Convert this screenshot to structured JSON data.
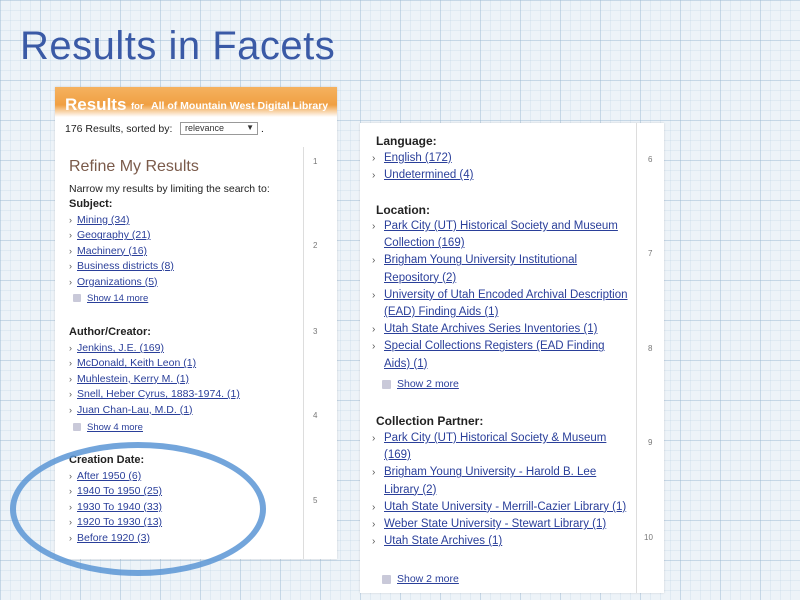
{
  "slide": {
    "title": "Results in Facets"
  },
  "left": {
    "header": {
      "results": "Results",
      "for": "for",
      "library": "All of Mountain West Digital Library"
    },
    "sort": {
      "text": "176 Results, sorted by:",
      "selected": "relevance",
      "caret": "▼",
      "dot": "."
    },
    "refine_title": "Refine My Results",
    "narrow_text": "Narrow my results by limiting the search to:",
    "subject": {
      "heading": "Subject:",
      "items": [
        "Mining (34)",
        "Geography (21)",
        "Machinery (16)",
        "Business districts (8)",
        "Organizations (5)"
      ],
      "show_more": "Show 14 more"
    },
    "author": {
      "heading": "Author/Creator:",
      "items": [
        "Jenkins, J.E. (169)",
        "McDonald, Keith Leon (1)",
        "Muhlestein, Kerry M. (1)",
        "Snell, Heber Cyrus, 1883-1974. (1)",
        "Juan Chan-Lau, M.D. (1)"
      ],
      "show_more": "Show 4 more"
    },
    "date": {
      "heading": "Creation Date:",
      "items": [
        "After 1950 (6)",
        "1940 To 1950 (25)",
        "1930 To 1940 (33)",
        "1920 To 1930 (13)",
        "Before 1920 (3)"
      ]
    },
    "page_numbers": [
      "1",
      "2",
      "3",
      "4",
      "5"
    ]
  },
  "right": {
    "language": {
      "heading": "Language:",
      "items": [
        "English (172)",
        "Undetermined (4)"
      ]
    },
    "location": {
      "heading": "Location:",
      "items": [
        "Park City (UT) Historical Society and Museum Collection (169)",
        "Brigham Young University Institutional Repository (2)",
        "University of Utah Encoded Archival Description (EAD) Finding Aids (1)",
        "Utah State Archives Series Inventories (1)",
        "Special Collections Registers (EAD Finding Aids) (1)"
      ],
      "show_more": "Show 2 more"
    },
    "partner": {
      "heading": "Collection Partner:",
      "items": [
        "Park City (UT) Historical Society & Museum (169)",
        "Brigham Young University - Harold B. Lee Library (2)",
        "Utah State University - Merrill-Cazier Library (1)",
        "Weber State University - Stewart Library (1)",
        "Utah State Archives (1)"
      ],
      "show_more": "Show 2 more"
    },
    "page_numbers": [
      "6",
      "7",
      "8",
      "9",
      "10"
    ]
  },
  "annotation": {
    "color": "#5b95d5"
  }
}
